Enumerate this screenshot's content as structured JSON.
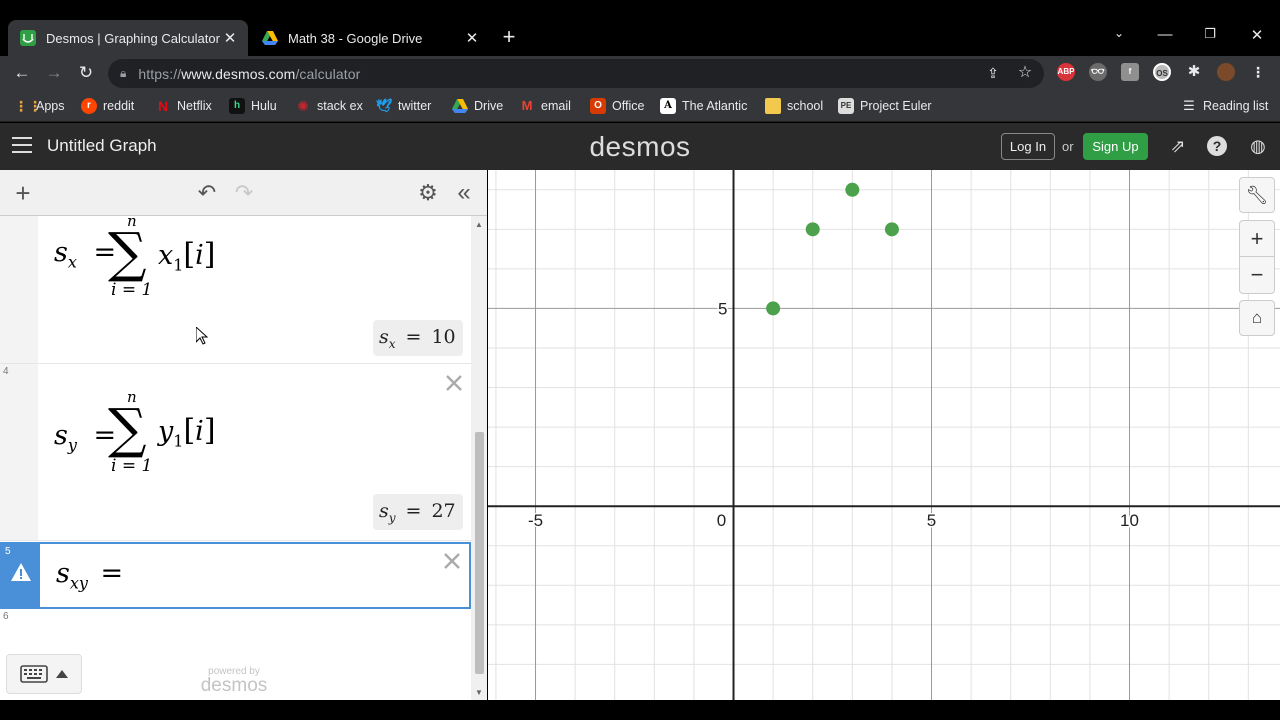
{
  "browser": {
    "tabs": [
      {
        "title": "Desmos | Graphing Calculator",
        "active": true
      },
      {
        "title": "Math 38 - Google Drive",
        "active": false
      }
    ],
    "url_scheme": "https://",
    "url_host": "www.desmos.com",
    "url_path": "/calculator",
    "bookmarks": [
      "Apps",
      "reddit",
      "Netflix",
      "Hulu",
      "stack ex",
      "twitter",
      "Drive",
      "email",
      "Office",
      "The Atlantic",
      "school",
      "Project Euler"
    ],
    "reading_list": "Reading list",
    "extensions": [
      "ABP",
      "OS"
    ]
  },
  "desmos": {
    "graph_title": "Untitled Graph",
    "logo": "desmos",
    "login_label": "Log In",
    "or_label": "or",
    "signup_label": "Sign Up",
    "powered_by": "powered by",
    "powered_logo": "desmos"
  },
  "expressions": [
    {
      "number": "",
      "lhs_var": "s",
      "lhs_sub": "x",
      "sum_top": "n",
      "sum_bottom": "i = 1",
      "body_var": "x",
      "body_sub": "1",
      "index": "i",
      "eval_var": "s",
      "eval_sub": "x",
      "eval_value": "10"
    },
    {
      "number": "4",
      "lhs_var": "s",
      "lhs_sub": "y",
      "sum_top": "n",
      "sum_bottom": "i = 1",
      "body_var": "y",
      "body_sub": "1",
      "index": "i",
      "eval_var": "s",
      "eval_sub": "y",
      "eval_value": "27"
    },
    {
      "number": "5",
      "lhs_var": "s",
      "lhs_sub": "xy",
      "warning": true
    },
    {
      "number": "6"
    }
  ],
  "colors": {
    "point": "#4ca24c",
    "selected": "#4a90d9",
    "signup": "#2f9e44"
  },
  "chart_data": {
    "type": "scatter",
    "x_ticks": [
      -5,
      0,
      5,
      10
    ],
    "y_ticks": [
      5
    ],
    "xlim": [
      -6.2,
      13.8
    ],
    "ylim": [
      -4.9,
      8.5
    ],
    "grid": true,
    "series": [
      {
        "points": [
          [
            1,
            5
          ],
          [
            2,
            7
          ],
          [
            3,
            8
          ],
          [
            4,
            7
          ]
        ],
        "color": "#4ca24c"
      }
    ]
  }
}
